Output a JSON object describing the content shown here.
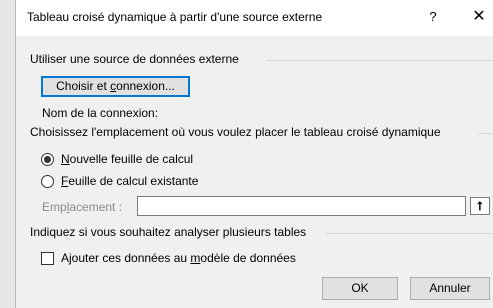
{
  "dialog": {
    "title": "Tableau croisé dynamique à partir d'une source externe",
    "help_label": "?",
    "close_label": "✕"
  },
  "source_group": {
    "label": "Utiliser une source de données externe",
    "choose_button": {
      "prefix": "Choisir et ",
      "accel": "c",
      "suffix": "onnexion..."
    },
    "connection_name_label": "Nom de la connexion:"
  },
  "placement_group": {
    "label": "Choisissez l'emplacement où vous voulez placer le tableau croisé dynamique",
    "options": [
      {
        "accel": "N",
        "rest": "ouvelle feuille de calcul",
        "selected": true
      },
      {
        "accel": "F",
        "rest": "euille de calcul existante",
        "selected": false
      }
    ],
    "location": {
      "label_pre": "Emp",
      "label_accel": "l",
      "label_post": "acement :",
      "value": "",
      "collapse_icon": "⭡"
    }
  },
  "tables_group": {
    "label": "Indiquez si vous souhaitez analyser plusieurs tables",
    "checkbox": {
      "pre": "Ajouter ces données au ",
      "accel": "m",
      "post": "odèle de données",
      "checked": false
    }
  },
  "footer": {
    "ok_label": "OK",
    "cancel_label": "Annuler"
  }
}
